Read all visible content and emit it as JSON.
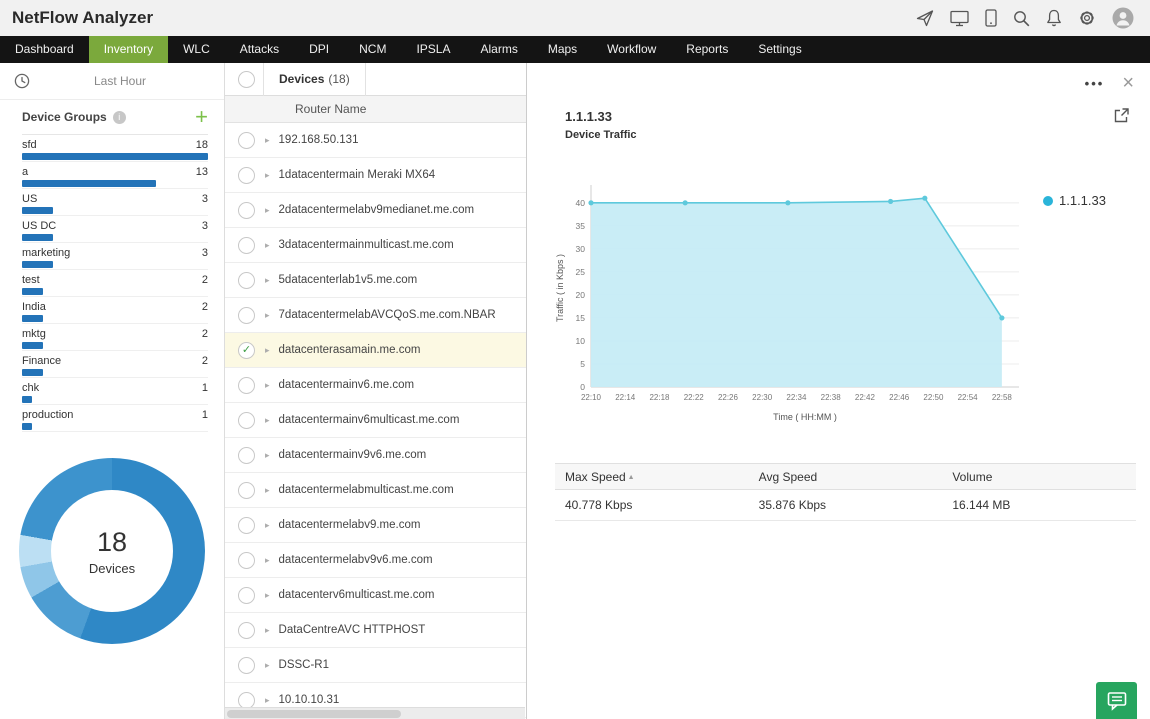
{
  "colors": {
    "nav_active_green": "#7ba93c",
    "group_bar_blue": "#2373b8",
    "selected_row_yellow": "#fcf9e3",
    "check_green": "#3d9e44",
    "chat_button_green": "#27a55f"
  },
  "header": {
    "title": "NetFlow Analyzer",
    "icons": [
      "send-icon",
      "screen-share-icon",
      "mobile-icon",
      "search-icon",
      "notifications-icon",
      "settings-icon",
      "user-avatar"
    ]
  },
  "nav": {
    "items": [
      {
        "label": "Dashboard",
        "active": false
      },
      {
        "label": "Inventory",
        "active": true
      },
      {
        "label": "WLC",
        "active": false
      },
      {
        "label": "Attacks",
        "active": false
      },
      {
        "label": "DPI",
        "active": false
      },
      {
        "label": "NCM",
        "active": false
      },
      {
        "label": "IPSLA",
        "active": false
      },
      {
        "label": "Alarms",
        "active": false
      },
      {
        "label": "Maps",
        "active": false
      },
      {
        "label": "Workflow",
        "active": false
      },
      {
        "label": "Reports",
        "active": false
      },
      {
        "label": "Settings",
        "active": false
      }
    ]
  },
  "sidebar": {
    "time_filter_label": "Last Hour",
    "groups_header": "Device Groups",
    "max_count": 18,
    "groups": [
      {
        "name": "sfd",
        "count": 18
      },
      {
        "name": "a",
        "count": 13
      },
      {
        "name": "US",
        "count": 3
      },
      {
        "name": "US DC",
        "count": 3
      },
      {
        "name": "marketing",
        "count": 3
      },
      {
        "name": "test",
        "count": 2
      },
      {
        "name": "India",
        "count": 2
      },
      {
        "name": "mktg",
        "count": 2
      },
      {
        "name": "Finance",
        "count": 2
      },
      {
        "name": "chk",
        "count": 1
      },
      {
        "name": "production",
        "count": 1
      }
    ],
    "donut": {
      "center_value": "18",
      "center_label": "Devices",
      "segments": [
        {
          "value": 10,
          "color": "#2f88c6"
        },
        {
          "value": 2,
          "color": "#4d9dd2"
        },
        {
          "value": 1,
          "color": "#8fc6e8"
        },
        {
          "value": 1,
          "color": "#bcdff3"
        },
        {
          "value": 4,
          "color": "#3d93cd"
        }
      ]
    }
  },
  "device_panel": {
    "tab_label": "Devices",
    "tab_count": "(18)",
    "column_header": "Router Name",
    "selected_index": 6,
    "devices": [
      "192.168.50.131",
      "1datacentermain Meraki MX64",
      "2datacentermelabv9medianet.me.com",
      "3datacentermainmulticast.me.com",
      "5datacenterlab1v5.me.com",
      "7datacentermelabAVCQoS.me.com.NBAR",
      "datacenterasamain.me.com",
      "datacentermainv6.me.com",
      "datacentermainv6multicast.me.com",
      "datacentermainv9v6.me.com",
      "datacentermelabmulticast.me.com",
      "datacentermelabv9.me.com",
      "datacentermelabv9v6.me.com",
      "datacenterv6multicast.me.com",
      "DataCentreAVC HTTPHOST",
      "DSSC-R1",
      "10.10.10.31"
    ]
  },
  "detail": {
    "title": "1.1.1.33",
    "subtitle": "Device Traffic",
    "menu_dots": "•••",
    "close_label": "×",
    "legend": {
      "label": "1.1.1.33",
      "color": "#2ab4d9"
    },
    "summary_table": {
      "headers": [
        "Max Speed",
        "Avg Speed",
        "Volume"
      ],
      "sort_column": 0,
      "rows": [
        [
          "40.778 Kbps",
          "35.876 Kbps",
          "16.144 MB"
        ]
      ]
    }
  },
  "chart_data": {
    "type": "area",
    "title": "Device Traffic",
    "series": [
      {
        "name": "1.1.1.33",
        "points": [
          {
            "x": "22:10",
            "y": 40
          },
          {
            "x": "22:21",
            "y": 40
          },
          {
            "x": "22:33",
            "y": 40
          },
          {
            "x": "22:45",
            "y": 40.3
          },
          {
            "x": "22:49",
            "y": 41
          },
          {
            "x": "22:58",
            "y": 15
          }
        ]
      }
    ],
    "x_ticks": [
      "22:10",
      "22:14",
      "22:18",
      "22:22",
      "22:26",
      "22:30",
      "22:34",
      "22:38",
      "22:42",
      "22:46",
      "22:50",
      "22:54",
      "22:58"
    ],
    "y_ticks": [
      0,
      5,
      10,
      15,
      20,
      25,
      30,
      35,
      40
    ],
    "ylim": [
      0,
      43
    ],
    "xlabel": "Time ( HH:MM )",
    "ylabel": "Traffic ( in Kbps )",
    "grid": true,
    "legend_position": "right",
    "line_color": "#5ec9dc",
    "fill_color": "#c6ecf5"
  }
}
